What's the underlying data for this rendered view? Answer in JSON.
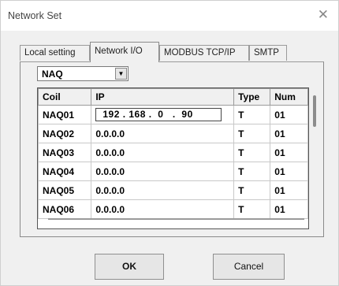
{
  "window": {
    "title": "Network Set",
    "close_glyph": "✕"
  },
  "tabs": [
    {
      "label": "Local setting",
      "active": false
    },
    {
      "label": "Network I/O",
      "active": true
    },
    {
      "label": "MODBUS TCP/IP",
      "active": false
    },
    {
      "label": "SMTP",
      "active": false
    }
  ],
  "select": {
    "value": "NAQ",
    "arrow_icon": "chevron-down-icon"
  },
  "table": {
    "columns": [
      "Coil",
      "IP",
      "Type",
      "Num"
    ],
    "rows": [
      {
        "coil": "NAQ01",
        "ip": "192 . 168 .  0   .  90",
        "type": "T",
        "num": "01",
        "editing": true
      },
      {
        "coil": "NAQ02",
        "ip": "0.0.0.0",
        "type": "T",
        "num": "01"
      },
      {
        "coil": "NAQ03",
        "ip": "0.0.0.0",
        "type": "T",
        "num": "01"
      },
      {
        "coil": "NAQ04",
        "ip": "0.0.0.0",
        "type": "T",
        "num": "01"
      },
      {
        "coil": "NAQ05",
        "ip": "0.0.0.0",
        "type": "T",
        "num": "01"
      },
      {
        "coil": "NAQ06",
        "ip": "0.0.0.0",
        "type": "T",
        "num": "01"
      }
    ]
  },
  "buttons": {
    "ok": "OK",
    "cancel": "Cancel"
  }
}
